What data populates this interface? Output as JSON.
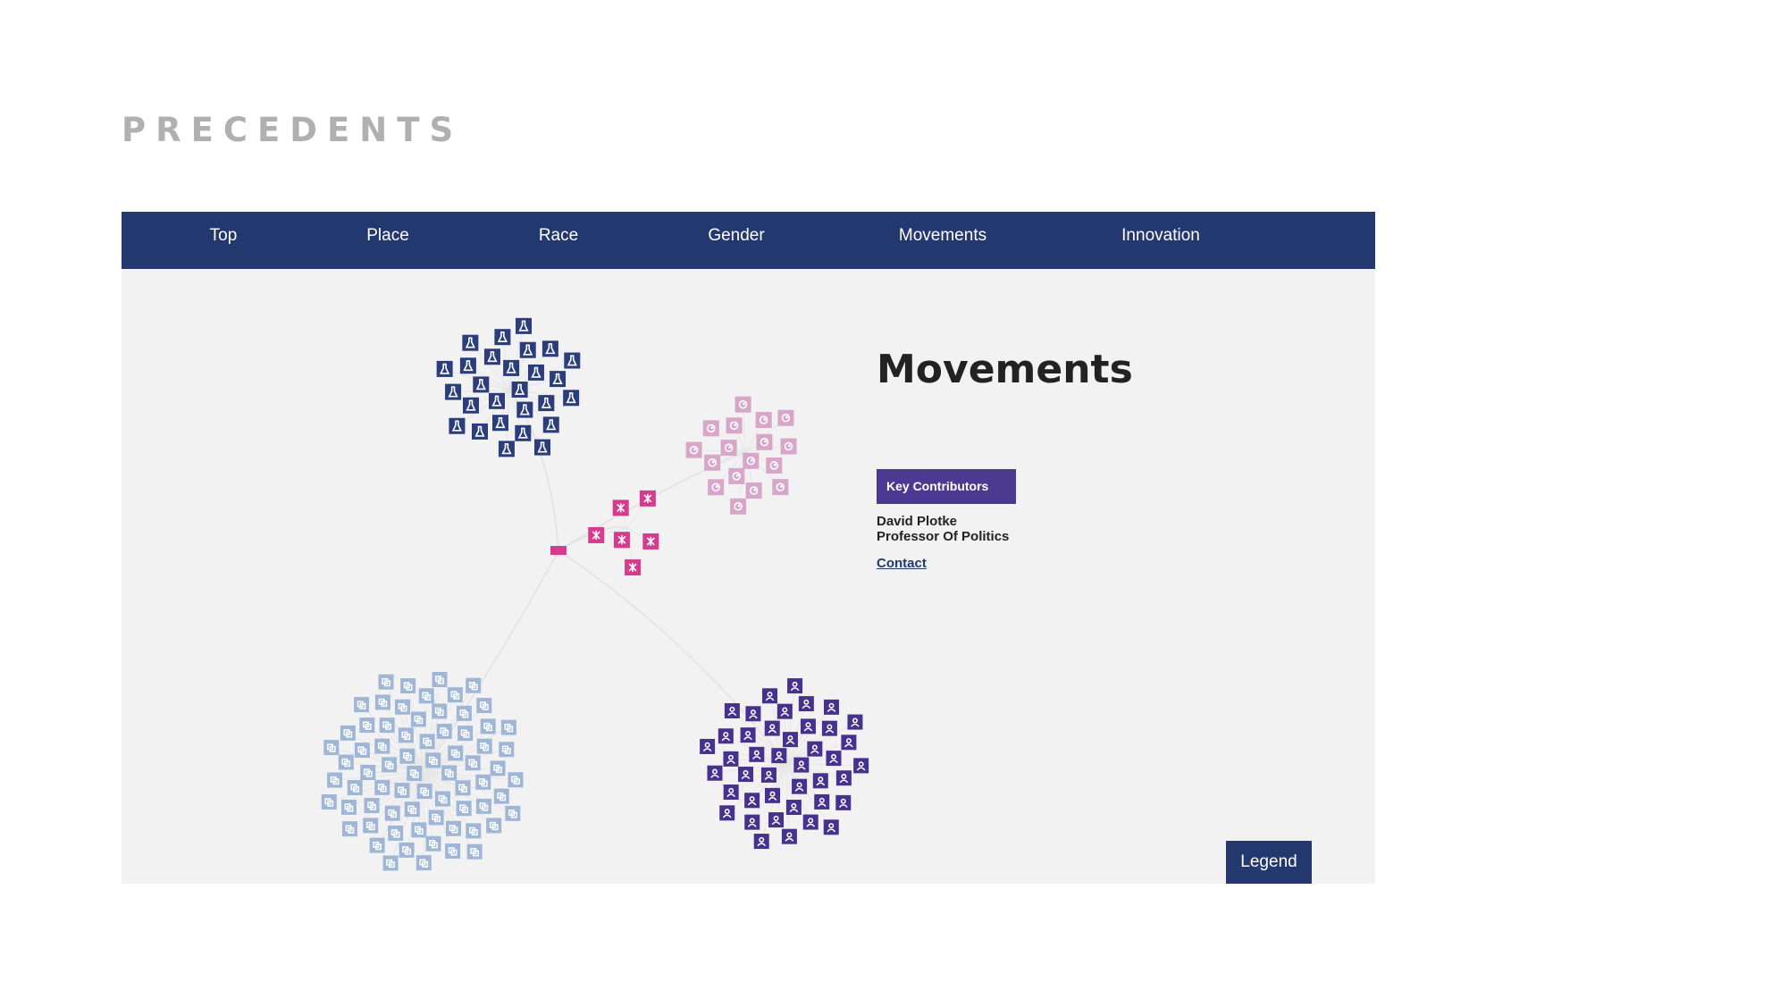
{
  "page": {
    "heading": "PRECEDENTS"
  },
  "nav": {
    "items": [
      "Top",
      "Place",
      "Race",
      "Gender",
      "Movements",
      "Innovation"
    ]
  },
  "panel": {
    "title": "Movements",
    "key_contributors_label": "Key Contributors",
    "contributor_name": "David Plotke",
    "contributor_role": "Professor Of Politics",
    "contact_label": "Contact"
  },
  "legend_label": "Legend",
  "colors": {
    "nav_bg": "#22386f",
    "accent_purple": "#4b3a92",
    "cluster_navy": "#2c3d7c",
    "cluster_pink_light": "#d7a6c9",
    "cluster_magenta": "#d63b8e",
    "cluster_light_blue": "#9fb6d6",
    "cluster_purple": "#46318f"
  },
  "clusters": [
    {
      "name": "navy-beaker-cluster",
      "icon": "beaker-icon",
      "color": "#2c3d7c",
      "count": 27
    },
    {
      "name": "pink-swirl-cluster",
      "icon": "swirl-icon",
      "color": "#d7a6c9",
      "count": 17
    },
    {
      "name": "magenta-cross-cluster",
      "icon": "cross-icon",
      "color": "#d63b8e",
      "count": 6
    },
    {
      "name": "light-blue-cluster",
      "icon": "copy-icon",
      "color": "#9fb6d6",
      "count": 70
    },
    {
      "name": "purple-person-cluster",
      "icon": "person-icon",
      "color": "#46318f",
      "count": 42
    }
  ]
}
